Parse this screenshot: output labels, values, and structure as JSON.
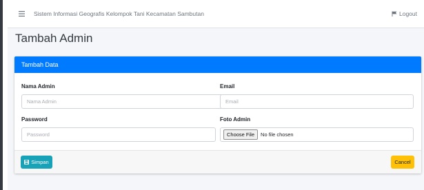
{
  "navbar": {
    "menu_icon": "hamburger-icon",
    "title": "Sistem Informasi Geografis Kelompok Tani Kecamatan Sambutan",
    "logout_icon": "flag-icon",
    "logout_label": "Logout"
  },
  "page": {
    "title": "Tambah Admin"
  },
  "card": {
    "header": "Tambah Data",
    "fields": {
      "nama_admin": {
        "label": "Nama Admin",
        "placeholder": "Nama Admin",
        "value": ""
      },
      "email": {
        "label": "Email",
        "placeholder": "Email",
        "value": ""
      },
      "password": {
        "label": "Password",
        "placeholder": "Password",
        "value": ""
      },
      "foto_admin": {
        "label": "Foto Admin",
        "button_label": "Choose File",
        "status": "No file chosen"
      }
    },
    "buttons": {
      "save_icon": "floppy-disk-icon",
      "save_label": "Simpan",
      "cancel_label": "Cancel"
    }
  },
  "colors": {
    "primary": "#007bff",
    "info": "#17a2b8",
    "warning": "#ffc107",
    "background": "#f4f6f9"
  }
}
